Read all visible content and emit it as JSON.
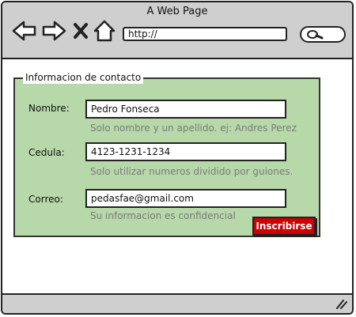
{
  "window": {
    "title": "A Web Page"
  },
  "toolbar": {
    "url": "http://",
    "icons": [
      "back-arrow-icon",
      "forward-arrow-icon",
      "close-icon",
      "home-icon",
      "search-icon",
      "resize-grip-icon"
    ]
  },
  "form": {
    "legend": "Informacion de contacto",
    "fields": [
      {
        "label": "Nombre:",
        "value": "Pedro Fonseca",
        "hint": "Solo nombre y un apellido. ej: Andres Perez"
      },
      {
        "label": "Cedula:",
        "value": "4123-1231-1234",
        "hint": "Solo utilizar numeros dividido por guiones."
      },
      {
        "label": "Correo:",
        "value": "pedasfae@gmail.com",
        "hint": "Su informacion es confidencial"
      }
    ],
    "submit_label": "Inscribirse"
  },
  "colors": {
    "chrome": "#cfcfcf",
    "form_background": "#b7d8a9",
    "button": "#cc0000",
    "hint_text": "#7a7a7a"
  }
}
